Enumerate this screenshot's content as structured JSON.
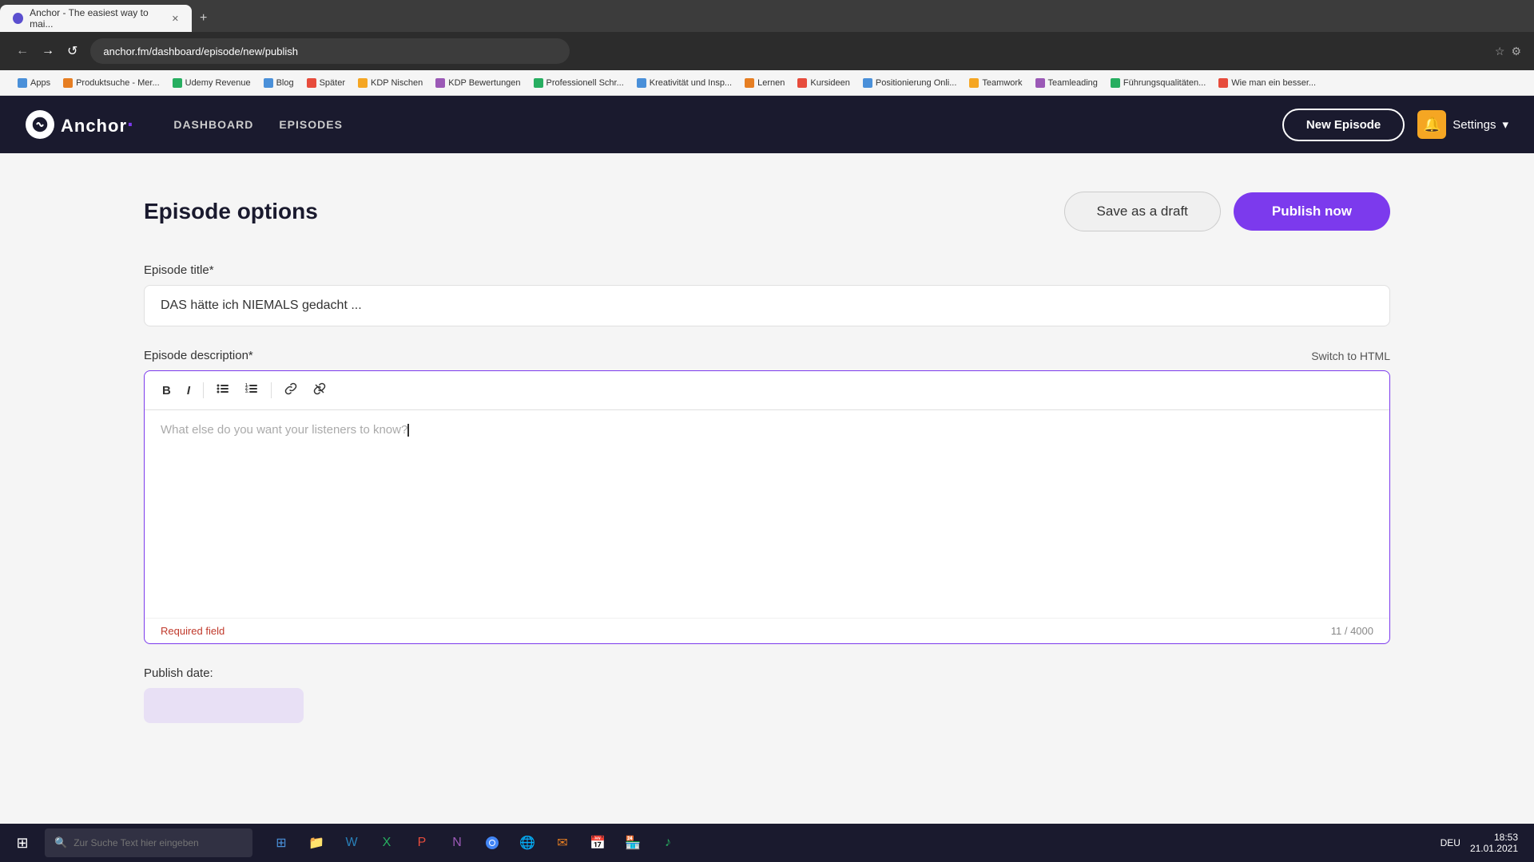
{
  "browser": {
    "tab_title": "Anchor - The easiest way to mai...",
    "tab_favicon": "A",
    "address": "anchor.fm/dashboard/episode/new/publish",
    "new_tab_label": "+",
    "bookmarks": [
      {
        "label": "Apps",
        "color": "#4a90d9"
      },
      {
        "label": "Produktsuche - Mer...",
        "color": "#e67e22"
      },
      {
        "label": "Udemy Revenue",
        "color": "#27ae60"
      },
      {
        "label": "Blog",
        "color": "#4a90d9"
      },
      {
        "label": "Später",
        "color": "#e74c3c"
      },
      {
        "label": "KDP Nischen",
        "color": "#f5a623"
      },
      {
        "label": "KDP Bewertungen",
        "color": "#9b59b6"
      },
      {
        "label": "Professionell Schr...",
        "color": "#27ae60"
      },
      {
        "label": "Kreativität und Insp...",
        "color": "#4a90d9"
      },
      {
        "label": "Lernen",
        "color": "#e67e22"
      },
      {
        "label": "Kursideen",
        "color": "#e74c3c"
      },
      {
        "label": "Positionierung Onli...",
        "color": "#4a90d9"
      },
      {
        "label": "Teamwork",
        "color": "#f5a623"
      },
      {
        "label": "Teamleading",
        "color": "#9b59b6"
      },
      {
        "label": "Führungsqualitäten...",
        "color": "#27ae60"
      },
      {
        "label": "Wie man ein besser...",
        "color": "#e74c3c"
      }
    ]
  },
  "nav": {
    "logo_text": "Anchor",
    "links": [
      "DASHBOARD",
      "EPISODES"
    ],
    "new_episode_label": "New Episode",
    "settings_label": "Settings"
  },
  "page": {
    "title": "Episode options",
    "save_draft_label": "Save as a draft",
    "publish_label": "Publish now"
  },
  "form": {
    "title_label": "Episode title*",
    "title_value": "DAS hätte ich NIEMALS gedacht ...",
    "description_label": "Episode description*",
    "switch_html_label": "Switch to HTML",
    "description_placeholder": "What else do you want your listeners to know?",
    "required_field_label": "Required field",
    "char_count": "11 / 4000",
    "publish_date_label": "Publish date:"
  },
  "taskbar": {
    "search_placeholder": "Zur Suche Text hier eingeben",
    "time": "18:53",
    "date": "21.01.2021",
    "lang": "DEU"
  }
}
